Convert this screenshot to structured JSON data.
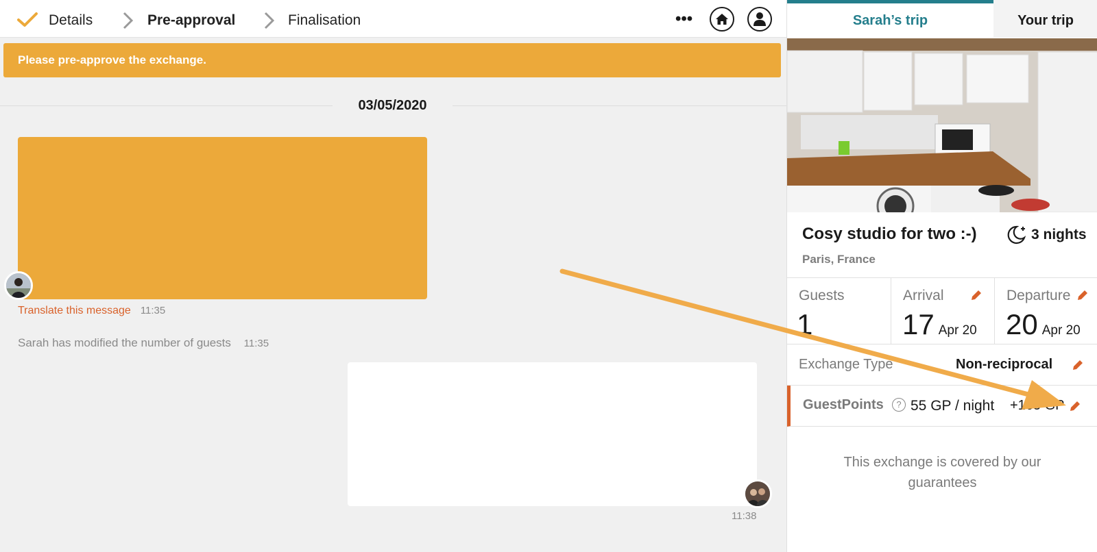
{
  "header": {
    "steps": [
      {
        "label": "Details",
        "state": "done"
      },
      {
        "label": "Pre-approval",
        "state": "current"
      },
      {
        "label": "Finalisation",
        "state": "upcoming"
      }
    ],
    "more_icon": "ellipsis-icon",
    "home_icon": "home-icon",
    "profile_icon": "user-icon"
  },
  "banner": {
    "text": "Please pre-approve the exchange."
  },
  "conversation": {
    "date": "03/05/2020",
    "messages": [
      {
        "translate_label": "Translate this message",
        "time": "11:35"
      },
      {
        "time": "11:38"
      }
    ],
    "system_event": {
      "text": "Sarah has modified the number of guests",
      "time": "11:35"
    }
  },
  "sidebar": {
    "tabs": [
      {
        "label": "Sarah’s trip",
        "active": true
      },
      {
        "label": "Your trip",
        "active": false
      }
    ],
    "listing": {
      "title": "Cosy studio for two :-)",
      "location": "Paris, France",
      "nights": "3 nights"
    },
    "guests": {
      "label": "Guests",
      "value": "1"
    },
    "arrival": {
      "label": "Arrival",
      "day": "17",
      "month": "Apr 20"
    },
    "departure": {
      "label": "Departure",
      "day": "20",
      "month": "Apr 20"
    },
    "exchange_type": {
      "label": "Exchange Type",
      "value": "Non-reciprocal"
    },
    "guestpoints": {
      "label": "GuestPoints",
      "help": "?",
      "rate": "55 GP / night",
      "total": "+165 GP"
    },
    "guarantee": "This exchange is covered by our guarantees"
  },
  "colors": {
    "accent_orange": "#eca93a",
    "teal": "#247e8c",
    "edit_orange": "#d9622b"
  }
}
